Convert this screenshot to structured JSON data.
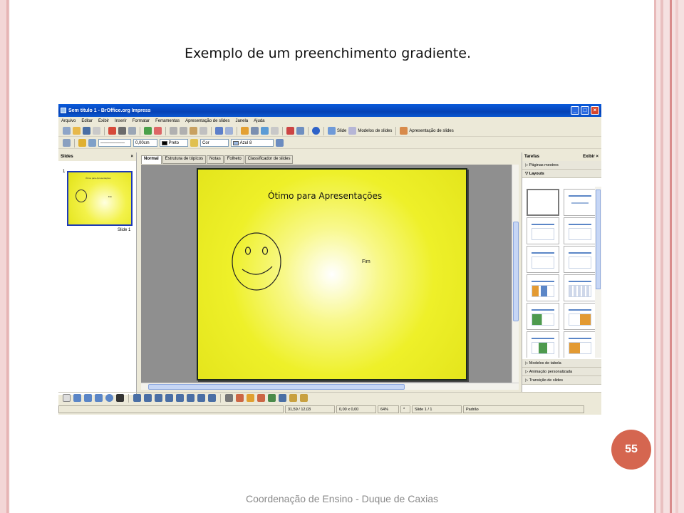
{
  "slide": {
    "title": "Exemplo de um preenchimento gradiente.",
    "footer": "Coordenação de Ensino - Duque de Caxias",
    "page_number": "55"
  },
  "app": {
    "window_title": "Sem título 1 - BrOffice.org Impress",
    "menu": [
      "Arquivo",
      "Editar",
      "Exibir",
      "Inserir",
      "Formatar",
      "Ferramentas",
      "Apresentação de slides",
      "Janela",
      "Ajuda"
    ],
    "toolbar1": {
      "slide_label": "Slide",
      "templates_label": "Modelos de slides",
      "presentation_label": "Apresentação de slides"
    },
    "toolbar2": {
      "line_width": "0,00cm",
      "line_color": "Preto",
      "area_style": "Cor",
      "area_color": "Azul 8"
    },
    "slides_panel": {
      "title": "Slides",
      "close": "×",
      "thumb_number": "1",
      "thumb_label": "Slide 1",
      "thumb_title": "Ótimo para Apresentações",
      "thumb_fim": "Fim"
    },
    "view_tabs": [
      "Normal",
      "Estrutura de tópicos",
      "Notas",
      "Folheto",
      "Classificador de slides"
    ],
    "slide_canvas": {
      "heading": "Ótimo para Apresentações",
      "text": "Fim"
    },
    "tasks_panel": {
      "title": "Tarefas",
      "view_label": "Exibir",
      "close": "×",
      "sections_top": [
        "Páginas mestres",
        "Layouts"
      ],
      "sections_bottom": [
        "Modelos de tabela",
        "Animação personalizada",
        "Transição de slides"
      ]
    },
    "statusbar": {
      "position": "31,59 / 12,03",
      "size": "0,00 x 0,00",
      "zoom": "64%",
      "modified": "*",
      "slide": "Slide 1 / 1",
      "layout": "Padrão"
    }
  },
  "colors": {
    "accent_badge": "#d56650",
    "title_bar": "#0642b5",
    "slide_gradient_center": "#ffffff",
    "slide_gradient_edge": "#e4e51c",
    "thumbnail_border": "#1c3ab8"
  }
}
